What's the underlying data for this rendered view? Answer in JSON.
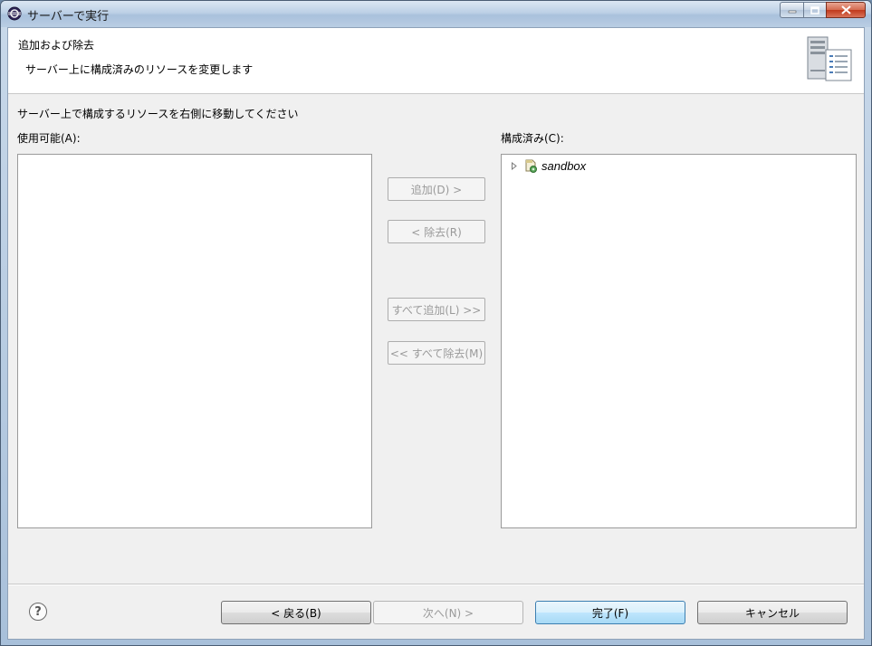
{
  "window": {
    "title": "サーバーで実行"
  },
  "banner": {
    "title": "追加および除去",
    "description": "サーバー上に構成済みのリソースを変更します"
  },
  "instruction": "サーバー上で構成するリソースを右側に移動してください",
  "available": {
    "label": "使用可能(A):",
    "items": []
  },
  "configured": {
    "label": "構成済み(C):",
    "items": [
      {
        "label": "sandbox",
        "icon": "project-icon",
        "expanded": false
      }
    ]
  },
  "move_buttons": {
    "add": "追加(D) >",
    "remove": "< 除去(R)",
    "add_all": "すべて追加(L) >>",
    "remove_all": "<< すべて除去(M)"
  },
  "footer": {
    "help": "?",
    "back": "< 戻る(B)",
    "next": "次へ(N) >",
    "finish": "完了(F)",
    "cancel": "キャンセル"
  },
  "colors": {
    "finish_highlight": "#bee6fd",
    "disabled_text": "#9a9a9a",
    "close_button": "#c0391c"
  }
}
